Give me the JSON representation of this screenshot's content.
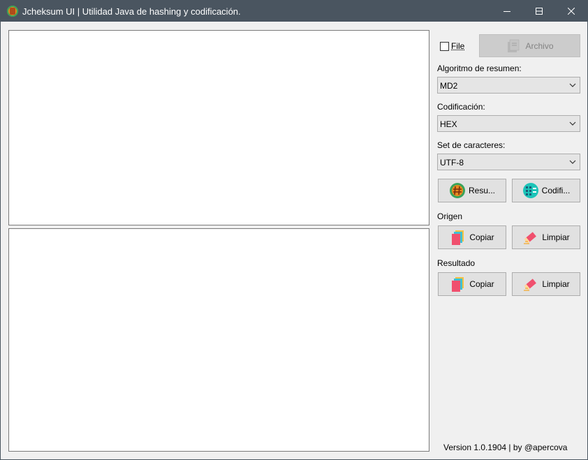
{
  "window": {
    "title": "Jcheksum UI | Utilidad Java de hashing y codificación."
  },
  "file": {
    "checkbox_label": "File",
    "checked": false,
    "archive_button_label": "Archivo"
  },
  "algorithm": {
    "label": "Algoritmo de resumen:",
    "selected": "MD2"
  },
  "encoding": {
    "label": "Codificación:",
    "selected": "HEX"
  },
  "charset": {
    "label": "Set de caracteres:",
    "selected": "UTF-8"
  },
  "actions": {
    "digest_label": "Resu...",
    "encode_label": "Codifi..."
  },
  "origin": {
    "label": "Origen",
    "copy_label": "Copiar",
    "clear_label": "Limpiar"
  },
  "result": {
    "label": "Resultado",
    "copy_label": "Copiar",
    "clear_label": "Limpiar"
  },
  "footer": {
    "version": "Version 1.0.1904 | by @apercova"
  },
  "colors": {
    "titlebar": "#4a5560",
    "window_bg": "#f0f0f0",
    "button_bg": "#e1e1e1",
    "disabled_button_bg": "#cccccc"
  }
}
